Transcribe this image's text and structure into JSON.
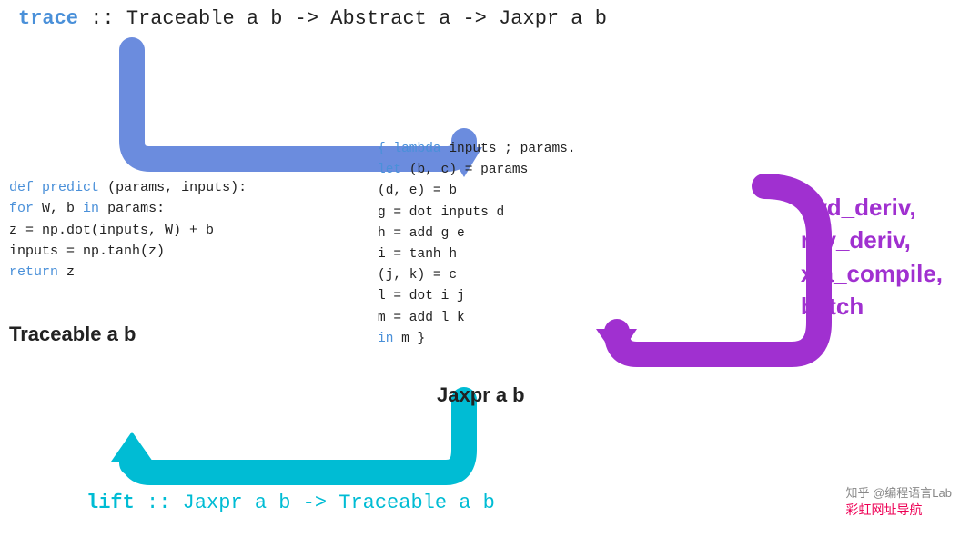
{
  "top_signature": {
    "trace": "trace",
    "rest": " :: Traceable a b -> Abstract a -> Jaxpr a b"
  },
  "code_predict": {
    "line1": "def predict(params, inputs):",
    "line2": "  for W, b in params:",
    "line3": "    z = np.dot(inputs, W) + b",
    "line4": "    inputs = np.tanh(z)",
    "line5": "  return z"
  },
  "label_traceable": "Traceable a b",
  "code_jaxpr": {
    "line1": "{ lambda inputs ; params.",
    "line2": "  let (b, c) = params",
    "line3": "      (d, e) = b",
    "line4": "      g = dot inputs d",
    "line5": "      h = add g e",
    "line6": "      i = tanh h",
    "line7": "      (j, k) = c",
    "line8": "      l = dot i j",
    "line9": "      m = add l k",
    "line10": "  in m }"
  },
  "label_jaxpr": "Jaxpr a b",
  "label_right": {
    "line1": "fwd_deriv,",
    "line2": "rev_deriv,",
    "line3": "xla_compile,",
    "line4": "batch"
  },
  "bottom_signature": {
    "lift": "lift",
    "rest": " :: Jaxpr a b -> Traceable a b"
  },
  "watermark": {
    "zhihu": "知乎 @编程语言Lab",
    "rainbow": "彩虹网址导航"
  },
  "colors": {
    "blue": "#4a90d9",
    "cyan": "#00bcd4",
    "purple": "#a030d0",
    "arrow_blue": "#6b8cde",
    "arrow_cyan": "#00bcd4",
    "arrow_purple": "#a030d0"
  }
}
